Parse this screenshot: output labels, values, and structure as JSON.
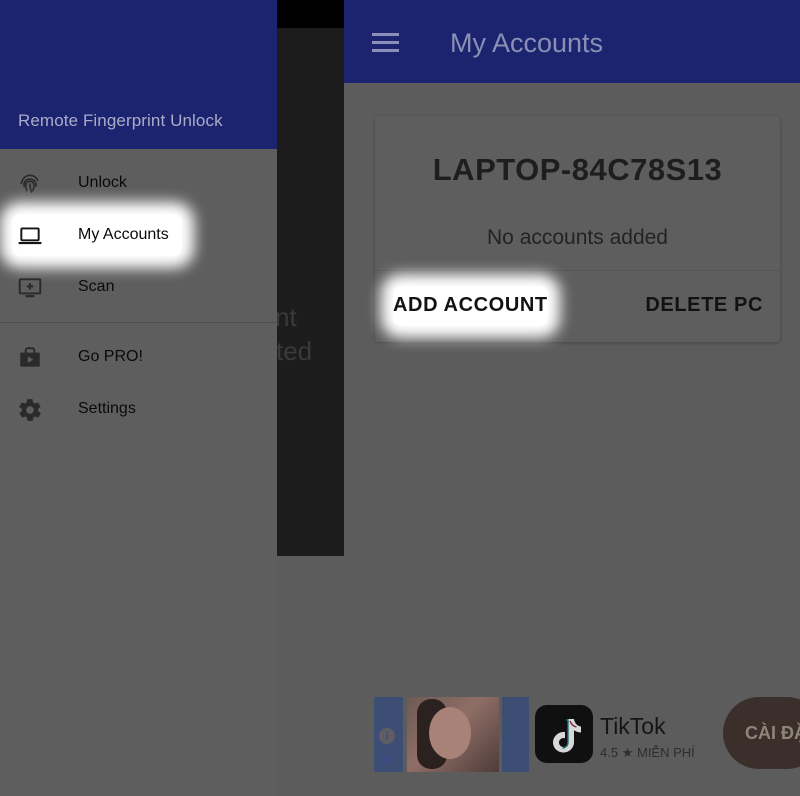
{
  "drawer": {
    "subtitle": "Remote Fingerprint Unlock",
    "items": [
      {
        "label": "Unlock",
        "icon": "fingerprint-icon"
      },
      {
        "label": "My Accounts",
        "icon": "laptop-icon",
        "highlighted": true
      },
      {
        "label": "Scan",
        "icon": "add-to-screen-icon"
      },
      {
        "label": "Go PRO!",
        "icon": "play-store-icon"
      },
      {
        "label": "Settings",
        "icon": "gear-icon"
      }
    ]
  },
  "background_fragment": {
    "line1": "nt",
    "line2": "ted"
  },
  "appbar": {
    "title": "My Accounts",
    "menu_icon": "hamburger-menu-icon"
  },
  "card": {
    "pc_name": "LAPTOP-84C78S13",
    "message": "No accounts added",
    "add_label": "ADD ACCOUNT",
    "delete_label": "DELETE PC"
  },
  "ad": {
    "app_name": "TikTok",
    "rating": "4.5",
    "price": "MIỄN PHÍ",
    "cta": "CÀI ĐẶT",
    "info_icon": "info-icon",
    "close_icon": "close-icon"
  },
  "colors": {
    "primary": "#1c2470",
    "scrim_background": "#5c5c5c",
    "text_dark": "#0a0a0a"
  }
}
